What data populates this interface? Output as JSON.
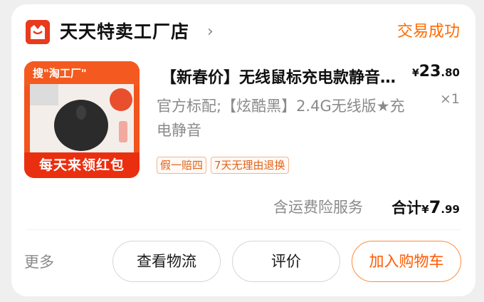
{
  "shop": {
    "logo_icon": "shop-bag-icon",
    "name": "天天特卖工厂店",
    "chevron": "›",
    "status": "交易成功"
  },
  "product": {
    "image": {
      "top_text": "搜\"淘工厂\"",
      "bottom_text": "每天来领红包"
    },
    "title": "【新春价】无线鼠标充电款静音办公",
    "spec": "官方标配;【炫酷黑】2.4G无线版★充电静音",
    "price": {
      "currency": "¥",
      "integer": "23",
      "decimal": ".80"
    },
    "quantity": "×1",
    "tags": [
      "假一赔四",
      "7天无理由退换"
    ]
  },
  "summary": {
    "insurance": "含运费险服务",
    "total_label": "合计",
    "currency": "¥",
    "integer": "7",
    "decimal": ".99"
  },
  "actions": {
    "more": "更多",
    "logistics": "查看物流",
    "review": "评价",
    "add_to_cart": "加入购物车"
  },
  "colors": {
    "accent": "#ff6a00",
    "brand_red": "#e93a1e"
  }
}
